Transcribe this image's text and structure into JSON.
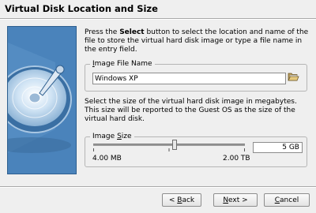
{
  "title": "Virtual Disk Location and Size",
  "intro": {
    "pre": "Press the ",
    "bold": "Select",
    "post": " button to select the location and name of the file to store the virtual hard disk image or type a file name in the entry field."
  },
  "image_file": {
    "legend_u": "I",
    "legend_rest": "mage File Name",
    "value": "Windows XP",
    "folder_icon": "folder-open-icon"
  },
  "size_description": "Select the size of the virtual hard disk image in megabytes. This size will be reported to the Guest OS as the size of the virtual hard disk.",
  "image_size": {
    "legend_pre": "Image ",
    "legend_u": "S",
    "legend_post": "ize",
    "min_label": "4.00 MB",
    "max_label": "2.00 TB",
    "value": "5 GB",
    "slider_position_fraction": 0.535
  },
  "buttons": {
    "back_pre": "< ",
    "back_u": "B",
    "back_post": "ack",
    "next_u": "N",
    "next_post": "ext >",
    "cancel_u": "C",
    "cancel_post": "ancel"
  },
  "colors": {
    "art_background": "#4a83bb",
    "separator": "#a8a8a8"
  }
}
